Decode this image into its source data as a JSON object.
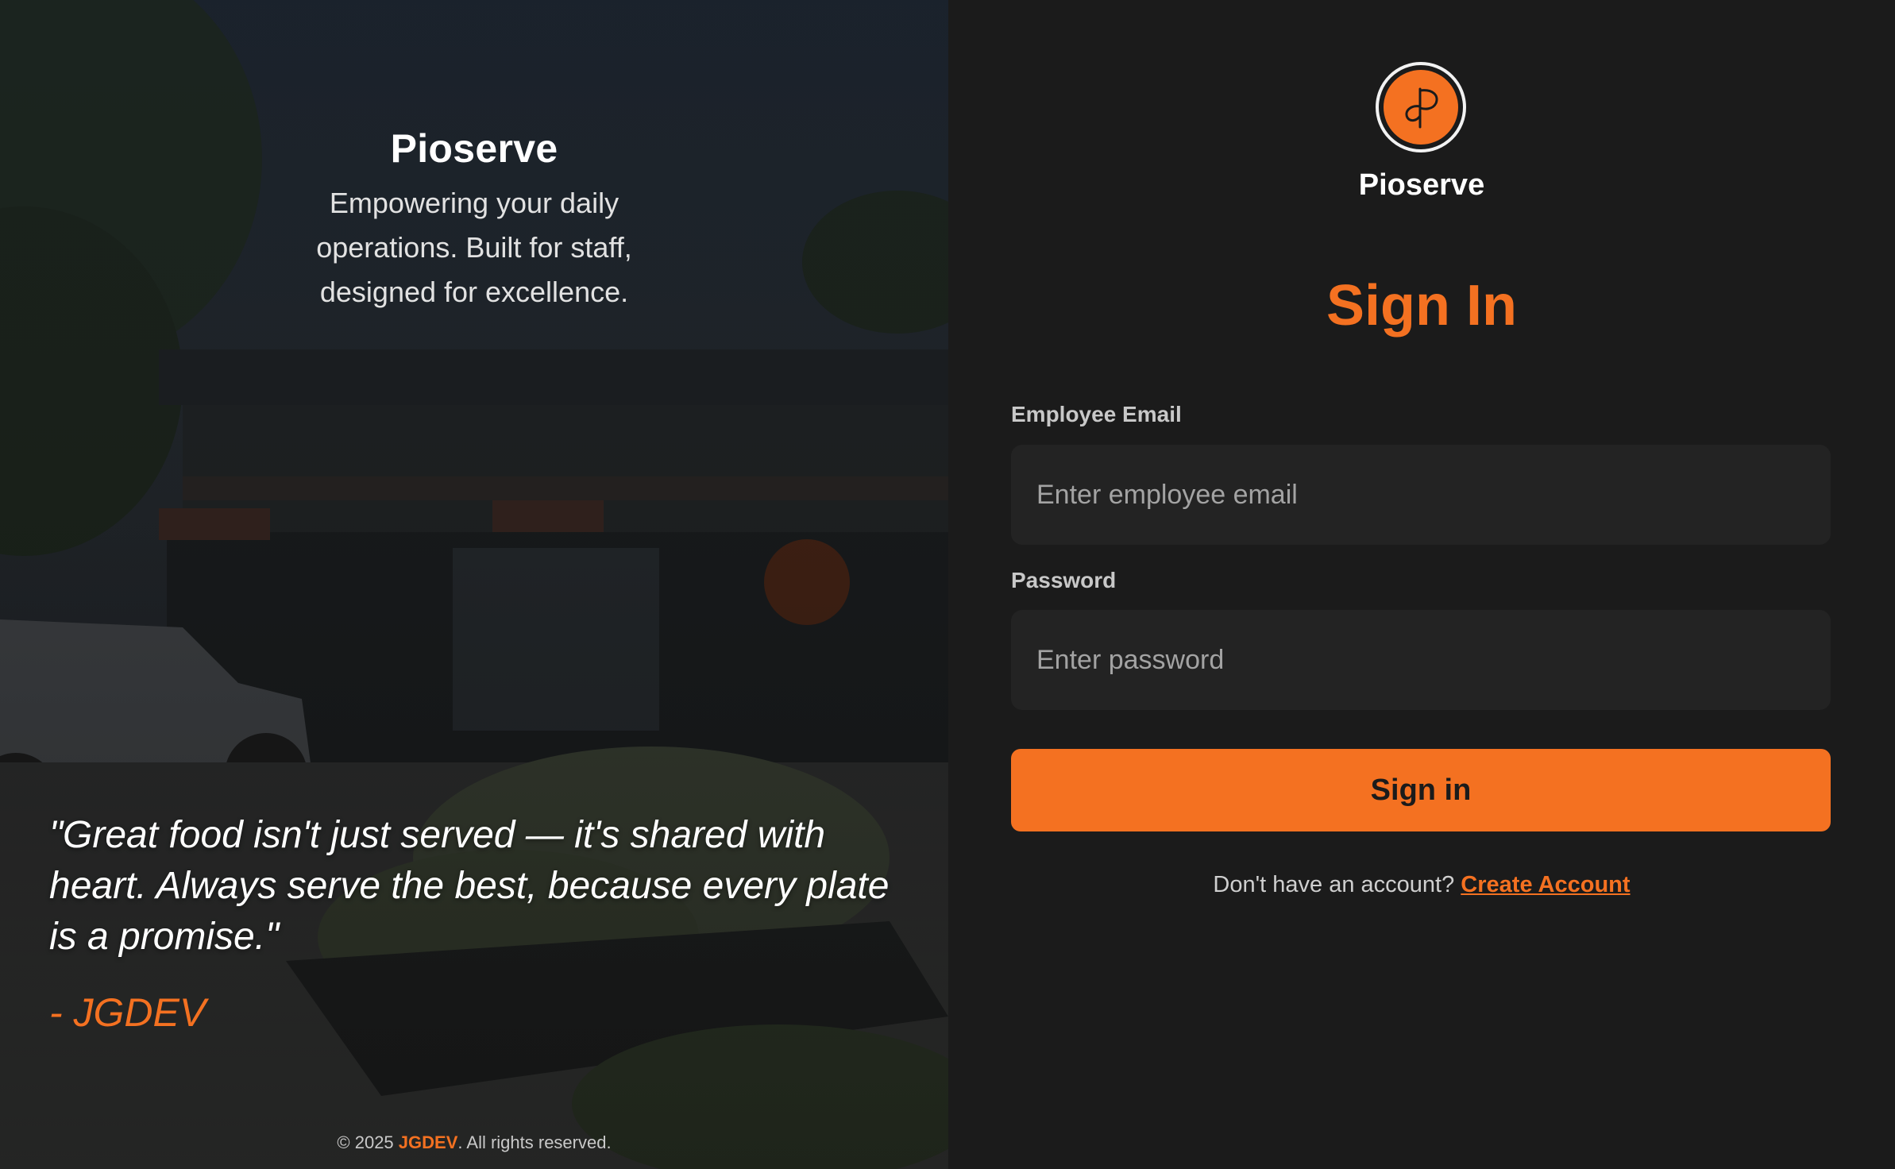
{
  "colors": {
    "accent": "#f47121",
    "panel_background": "#1b1b1b",
    "input_background": "#232323",
    "text_primary": "#ffffff",
    "text_muted": "#cfcfcf"
  },
  "hero": {
    "brand": "Pioserve",
    "tagline": "Empowering your daily operations. Built for staff, designed for excellence.",
    "quote": "\"Great food isn't just served — it's shared with heart. Always serve the best, because every plate is a promise.\"",
    "quote_author": "- JGDEV",
    "background_icon": "restaurant-photo"
  },
  "footer": {
    "prefix": "© 2025 ",
    "owner": "JGDEV",
    "suffix": ". All rights reserved."
  },
  "form": {
    "logo_icon": "pioserve-logo-icon",
    "brand": "Pioserve",
    "title": "Sign In",
    "email": {
      "label": "Employee Email",
      "placeholder": "Enter employee email",
      "value": ""
    },
    "password": {
      "label": "Password",
      "placeholder": "Enter password",
      "value": ""
    },
    "submit_label": "Sign in",
    "signup_prompt": "Don't have an account? ",
    "signup_link": "Create Account"
  }
}
